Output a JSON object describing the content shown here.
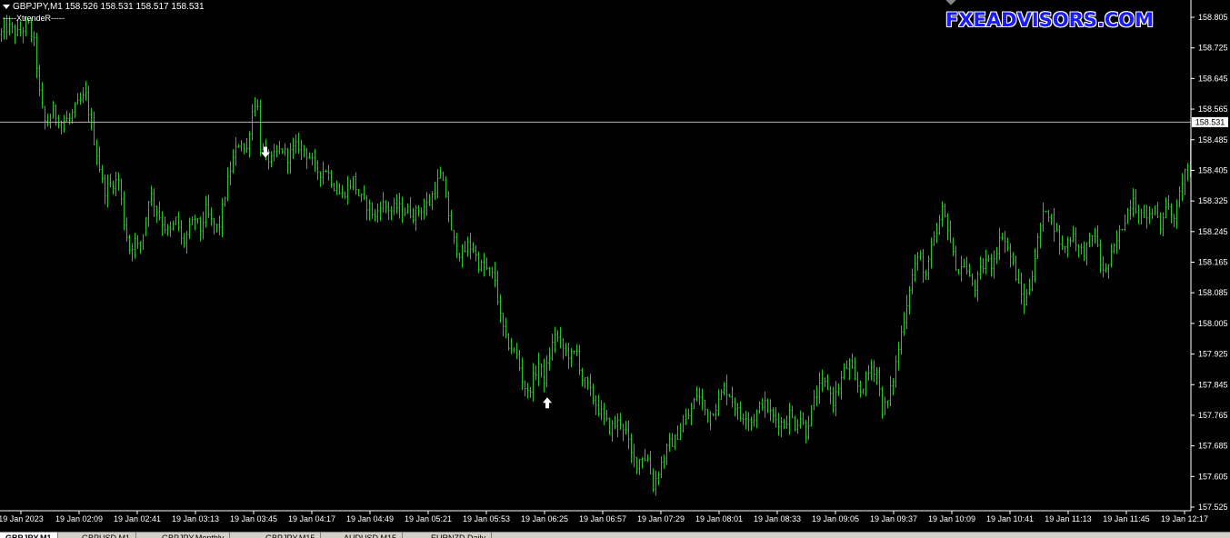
{
  "header": {
    "symbol_line": "GBPJPY,M1  158.526 158.531 158.517 158.531",
    "indicator": "-----XtrendeR-----"
  },
  "brand": {
    "logo_text": "FXEADVISORS.COM"
  },
  "colors": {
    "background": "#000000",
    "bars": "#22c822",
    "axis": "#ffffff",
    "current_price_line": "#b4b4b4"
  },
  "tabs": [
    {
      "label": "GBPJPY,M1",
      "active": true
    },
    {
      "label": "GBPUSD,M1",
      "active": false
    },
    {
      "label": "GBPJPY,Monthly",
      "active": false
    },
    {
      "label": "GBPJPY,M15",
      "active": false
    },
    {
      "label": "AUDUSD,M15",
      "active": false
    },
    {
      "label": "EURNZD,Daily",
      "active": false
    }
  ],
  "chart_data": {
    "type": "ohlc-bars",
    "symbol": "GBPJPY",
    "timeframe": "M1",
    "current_price": 158.531,
    "y_ticks": [
      "158.805",
      "158.725",
      "158.645",
      "158.565",
      "158.485",
      "158.405",
      "158.325",
      "158.245",
      "158.165",
      "158.085",
      "158.005",
      "157.925",
      "157.845",
      "157.765",
      "157.685",
      "157.605",
      "157.525"
    ],
    "ylim": [
      157.52,
      158.83
    ],
    "x_ticks": [
      "19 Jan 2023",
      "19 Jan 02:09",
      "19 Jan 02:41",
      "19 Jan 03:13",
      "19 Jan 03:45",
      "19 Jan 04:17",
      "19 Jan 04:49",
      "19 Jan 05:21",
      "19 Jan 05:53",
      "19 Jan 06:25",
      "19 Jan 06:57",
      "19 Jan 07:29",
      "19 Jan 08:01",
      "19 Jan 08:33",
      "19 Jan 09:05",
      "19 Jan 09:37",
      "19 Jan 10:09",
      "19 Jan 10:41",
      "19 Jan 11:13",
      "19 Jan 11:45",
      "19 Jan 12:17"
    ],
    "path_keys": [
      [
        0,
        158.76
      ],
      [
        8,
        158.78
      ],
      [
        20,
        158.76
      ],
      [
        30,
        158.79
      ],
      [
        38,
        158.73
      ],
      [
        44,
        158.58
      ],
      [
        50,
        158.52
      ],
      [
        58,
        158.56
      ],
      [
        66,
        158.53
      ],
      [
        76,
        158.54
      ],
      [
        86,
        158.58
      ],
      [
        94,
        158.6
      ],
      [
        100,
        158.52
      ],
      [
        106,
        158.45
      ],
      [
        114,
        158.35
      ],
      [
        122,
        158.37
      ],
      [
        130,
        158.38
      ],
      [
        136,
        158.27
      ],
      [
        142,
        158.2
      ],
      [
        148,
        158.22
      ],
      [
        152,
        158.2
      ],
      [
        158,
        158.25
      ],
      [
        164,
        158.35
      ],
      [
        172,
        158.3
      ],
      [
        180,
        158.26
      ],
      [
        186,
        158.24
      ],
      [
        194,
        158.28
      ],
      [
        200,
        158.21
      ],
      [
        208,
        158.25
      ],
      [
        214,
        158.28
      ],
      [
        220,
        158.25
      ],
      [
        226,
        158.3
      ],
      [
        232,
        158.27
      ],
      [
        240,
        158.25
      ],
      [
        246,
        158.33
      ],
      [
        252,
        158.4
      ],
      [
        258,
        158.45
      ],
      [
        264,
        158.49
      ],
      [
        270,
        158.44
      ],
      [
        276,
        158.55
      ],
      [
        282,
        158.6
      ],
      [
        286,
        158.47
      ],
      [
        292,
        158.44
      ],
      [
        298,
        158.43
      ],
      [
        304,
        158.45
      ],
      [
        310,
        158.46
      ],
      [
        316,
        158.44
      ],
      [
        322,
        158.46
      ],
      [
        328,
        158.47
      ],
      [
        334,
        158.46
      ],
      [
        340,
        158.44
      ],
      [
        346,
        158.41
      ],
      [
        352,
        158.4
      ],
      [
        358,
        158.41
      ],
      [
        364,
        158.38
      ],
      [
        370,
        158.35
      ],
      [
        376,
        158.34
      ],
      [
        382,
        158.36
      ],
      [
        388,
        158.38
      ],
      [
        394,
        158.34
      ],
      [
        400,
        158.32
      ],
      [
        406,
        158.31
      ],
      [
        412,
        158.28
      ],
      [
        418,
        158.32
      ],
      [
        424,
        158.31
      ],
      [
        430,
        158.3
      ],
      [
        436,
        158.31
      ],
      [
        442,
        158.3
      ],
      [
        448,
        158.3
      ],
      [
        454,
        158.29
      ],
      [
        460,
        158.3
      ],
      [
        466,
        158.31
      ],
      [
        472,
        158.32
      ],
      [
        478,
        158.36
      ],
      [
        484,
        158.39
      ],
      [
        490,
        158.34
      ],
      [
        496,
        158.24
      ],
      [
        502,
        158.2
      ],
      [
        508,
        158.18
      ],
      [
        514,
        158.21
      ],
      [
        520,
        158.2
      ],
      [
        526,
        158.16
      ],
      [
        532,
        158.15
      ],
      [
        538,
        158.14
      ],
      [
        544,
        158.12
      ],
      [
        550,
        158.02
      ],
      [
        556,
        157.96
      ],
      [
        562,
        157.94
      ],
      [
        568,
        157.92
      ],
      [
        574,
        157.86
      ],
      [
        580,
        157.82
      ],
      [
        586,
        157.86
      ],
      [
        592,
        157.9
      ],
      [
        598,
        157.86
      ],
      [
        604,
        157.92
      ],
      [
        610,
        157.98
      ],
      [
        616,
        157.95
      ],
      [
        622,
        157.93
      ],
      [
        628,
        157.92
      ],
      [
        634,
        157.93
      ],
      [
        640,
        157.86
      ],
      [
        646,
        157.84
      ],
      [
        652,
        157.81
      ],
      [
        658,
        157.78
      ],
      [
        664,
        157.76
      ],
      [
        670,
        157.73
      ],
      [
        676,
        157.74
      ],
      [
        682,
        157.75
      ],
      [
        688,
        157.72
      ],
      [
        694,
        157.66
      ],
      [
        700,
        157.64
      ],
      [
        706,
        157.66
      ],
      [
        712,
        157.65
      ],
      [
        718,
        157.58
      ],
      [
        724,
        157.62
      ],
      [
        730,
        157.66
      ],
      [
        736,
        157.69
      ],
      [
        742,
        157.7
      ],
      [
        748,
        157.73
      ],
      [
        754,
        157.75
      ],
      [
        760,
        157.78
      ],
      [
        766,
        157.82
      ],
      [
        772,
        157.8
      ],
      [
        778,
        157.76
      ],
      [
        784,
        157.78
      ],
      [
        790,
        157.8
      ],
      [
        796,
        157.84
      ],
      [
        802,
        157.82
      ],
      [
        808,
        157.79
      ],
      [
        814,
        157.76
      ],
      [
        820,
        157.77
      ],
      [
        826,
        157.75
      ],
      [
        832,
        157.77
      ],
      [
        838,
        157.8
      ],
      [
        844,
        157.78
      ],
      [
        850,
        157.76
      ],
      [
        856,
        157.75
      ],
      [
        862,
        157.74
      ],
      [
        868,
        157.77
      ],
      [
        874,
        157.74
      ],
      [
        880,
        157.76
      ],
      [
        886,
        157.72
      ],
      [
        892,
        157.78
      ],
      [
        898,
        157.82
      ],
      [
        904,
        157.85
      ],
      [
        910,
        157.84
      ],
      [
        916,
        157.8
      ],
      [
        922,
        157.84
      ],
      [
        928,
        157.88
      ],
      [
        934,
        157.9
      ],
      [
        940,
        157.85
      ],
      [
        946,
        157.83
      ],
      [
        952,
        157.86
      ],
      [
        958,
        157.89
      ],
      [
        964,
        157.88
      ],
      [
        970,
        157.78
      ],
      [
        976,
        157.8
      ],
      [
        982,
        157.86
      ],
      [
        988,
        157.94
      ],
      [
        994,
        158.02
      ],
      [
        1000,
        158.1
      ],
      [
        1006,
        158.16
      ],
      [
        1012,
        158.18
      ],
      [
        1018,
        158.12
      ],
      [
        1024,
        158.2
      ],
      [
        1030,
        158.24
      ],
      [
        1036,
        158.3
      ],
      [
        1042,
        158.26
      ],
      [
        1048,
        158.18
      ],
      [
        1054,
        158.14
      ],
      [
        1060,
        158.16
      ],
      [
        1066,
        158.12
      ],
      [
        1072,
        158.1
      ],
      [
        1078,
        158.14
      ],
      [
        1084,
        158.17
      ],
      [
        1090,
        158.16
      ],
      [
        1096,
        158.2
      ],
      [
        1102,
        158.24
      ],
      [
        1108,
        158.2
      ],
      [
        1114,
        158.16
      ],
      [
        1120,
        158.1
      ],
      [
        1126,
        158.06
      ],
      [
        1132,
        158.1
      ],
      [
        1138,
        158.18
      ],
      [
        1144,
        158.26
      ],
      [
        1150,
        158.31
      ],
      [
        1156,
        158.28
      ],
      [
        1162,
        158.24
      ],
      [
        1168,
        158.2
      ],
      [
        1174,
        158.22
      ],
      [
        1180,
        158.24
      ],
      [
        1186,
        158.2
      ],
      [
        1192,
        158.19
      ],
      [
        1198,
        158.22
      ],
      [
        1204,
        158.24
      ],
      [
        1210,
        158.16
      ],
      [
        1216,
        158.14
      ],
      [
        1222,
        158.18
      ],
      [
        1228,
        158.22
      ],
      [
        1234,
        158.26
      ],
      [
        1240,
        158.3
      ],
      [
        1246,
        158.34
      ],
      [
        1252,
        158.28
      ],
      [
        1258,
        158.3
      ],
      [
        1264,
        158.28
      ],
      [
        1270,
        158.31
      ],
      [
        1276,
        158.26
      ],
      [
        1282,
        158.32
      ],
      [
        1288,
        158.28
      ],
      [
        1294,
        158.3
      ],
      [
        1300,
        158.38
      ],
      [
        1306,
        158.42
      ],
      [
        1310,
        158.46
      ]
    ],
    "signals": [
      {
        "type": "sell",
        "price": 158.45
      },
      {
        "type": "buy",
        "price": 157.8
      }
    ]
  }
}
